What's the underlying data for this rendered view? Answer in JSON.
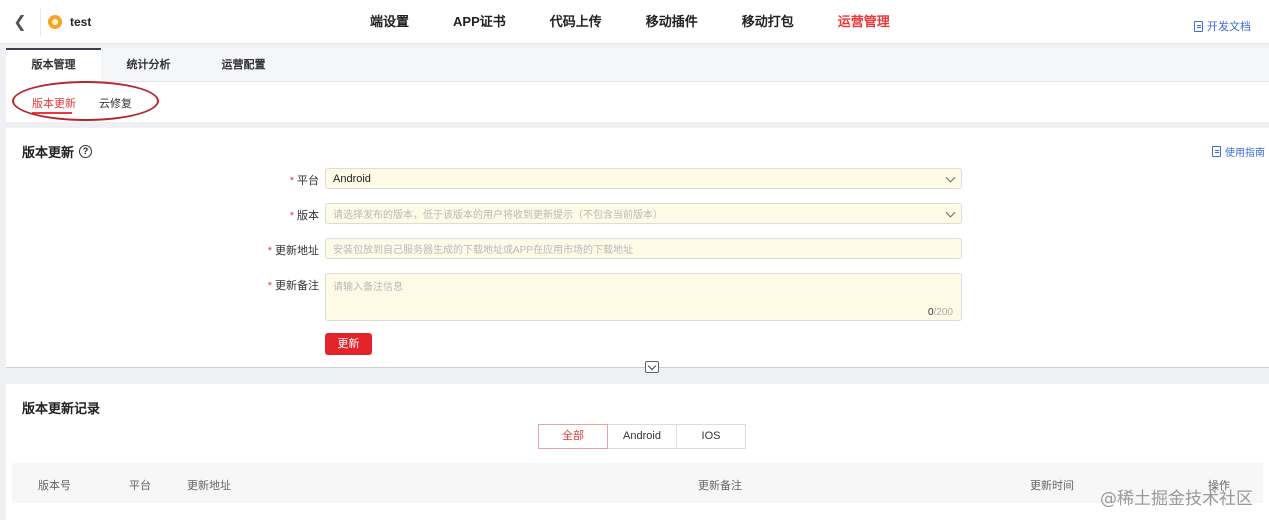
{
  "app": {
    "name": "test"
  },
  "main_nav": {
    "items": [
      {
        "label": "端设置"
      },
      {
        "label": "APP证书"
      },
      {
        "label": "代码上传"
      },
      {
        "label": "移动插件"
      },
      {
        "label": "移动打包"
      },
      {
        "label": "运营管理",
        "active": true
      }
    ],
    "doc_link": "开发文档"
  },
  "sub_tabs": [
    {
      "label": "版本管理",
      "active": true
    },
    {
      "label": "统计分析"
    },
    {
      "label": "运营配置"
    }
  ],
  "third_tabs": [
    {
      "label": "版本更新",
      "active": true
    },
    {
      "label": "云修复"
    }
  ],
  "form": {
    "title": "版本更新",
    "guide_label": "使用指南",
    "platform": {
      "label": "平台",
      "value": "Android"
    },
    "version": {
      "label": "版本",
      "placeholder": "请选择发布的版本，低于该版本的用户将收到更新提示（不包含当前版本）"
    },
    "update_url": {
      "label": "更新地址",
      "placeholder": "安装包放到自己服务器生成的下载地址或APP在应用市场的下载地址"
    },
    "update_note": {
      "label": "更新备注",
      "placeholder": "请输入备注信息",
      "count": "0",
      "max": "/200"
    },
    "submit_label": "更新"
  },
  "records": {
    "title": "版本更新记录",
    "filters": [
      {
        "label": "全部",
        "active": true
      },
      {
        "label": "Android"
      },
      {
        "label": "IOS"
      }
    ],
    "columns": [
      "版本号",
      "平台",
      "更新地址",
      "更新备注",
      "更新时间",
      "操作"
    ]
  },
  "watermark": "@稀土掘金技术社区",
  "colors": {
    "accent": "#e83a3a",
    "link": "#3d6bdf",
    "input_bg": "#fdfbe6"
  }
}
